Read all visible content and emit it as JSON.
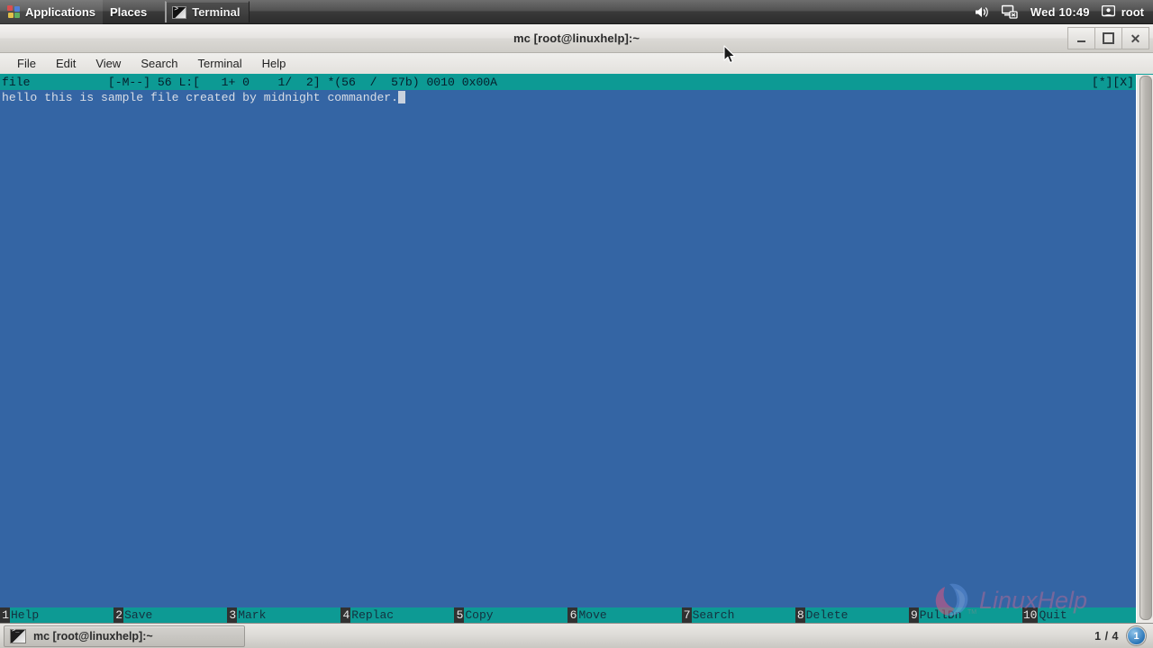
{
  "top_panel": {
    "applications_label": "Applications",
    "places_label": "Places",
    "task_terminal_label": "Terminal",
    "clock": "Wed 10:49",
    "user": "root",
    "icons": {
      "applications": "applications-icon",
      "volume": "speaker-icon",
      "network": "network-disconnected-icon",
      "user": "user-icon"
    }
  },
  "window": {
    "title": "mc [root@linuxhelp]:~",
    "controls": {
      "minimize": "minimize-icon",
      "maximize": "maximize-icon",
      "close": "close-icon"
    }
  },
  "menubar": {
    "items": [
      {
        "label": "File"
      },
      {
        "label": "Edit"
      },
      {
        "label": "View"
      },
      {
        "label": "Search"
      },
      {
        "label": "Terminal"
      },
      {
        "label": "Help"
      }
    ]
  },
  "editor": {
    "status_left": "file           [-M--] 56 L:[   1+ 0    1/  2] *(56  /  57b) 0010 0x00A",
    "status_right": "[*][X]",
    "filename": "file",
    "modified_flag": "[-M--]",
    "column": "56",
    "line_info": "L:[   1+ 0    1/  2]",
    "bytes": "*(56  /  57b)",
    "offset_dec": "0010",
    "offset_hex": "0x00A",
    "lines": [
      "hello this is sample file created by midnight commander."
    ],
    "colors": {
      "background": "#3465a4",
      "status_bar": "#0d9a94",
      "text": "#d8dde6",
      "fkey_label": "#14313f",
      "fkey_number_bg": "#313131"
    }
  },
  "function_keys": [
    {
      "num": "1",
      "label": "Help"
    },
    {
      "num": "2",
      "label": "Save"
    },
    {
      "num": "3",
      "label": "Mark"
    },
    {
      "num": "4",
      "label": "Replac"
    },
    {
      "num": "5",
      "label": "Copy"
    },
    {
      "num": "6",
      "label": "Move"
    },
    {
      "num": "7",
      "label": "Search"
    },
    {
      "num": "8",
      "label": "Delete"
    },
    {
      "num": "9",
      "label": "PullDn"
    },
    {
      "num": "10",
      "label": "Quit"
    }
  ],
  "watermark": {
    "text": "LinuxHelp",
    "mark": "TM"
  },
  "bottom_panel": {
    "task_label": "mc [root@linuxhelp]:~",
    "workspace_count": "1 / 4",
    "workspace_current": "1"
  }
}
